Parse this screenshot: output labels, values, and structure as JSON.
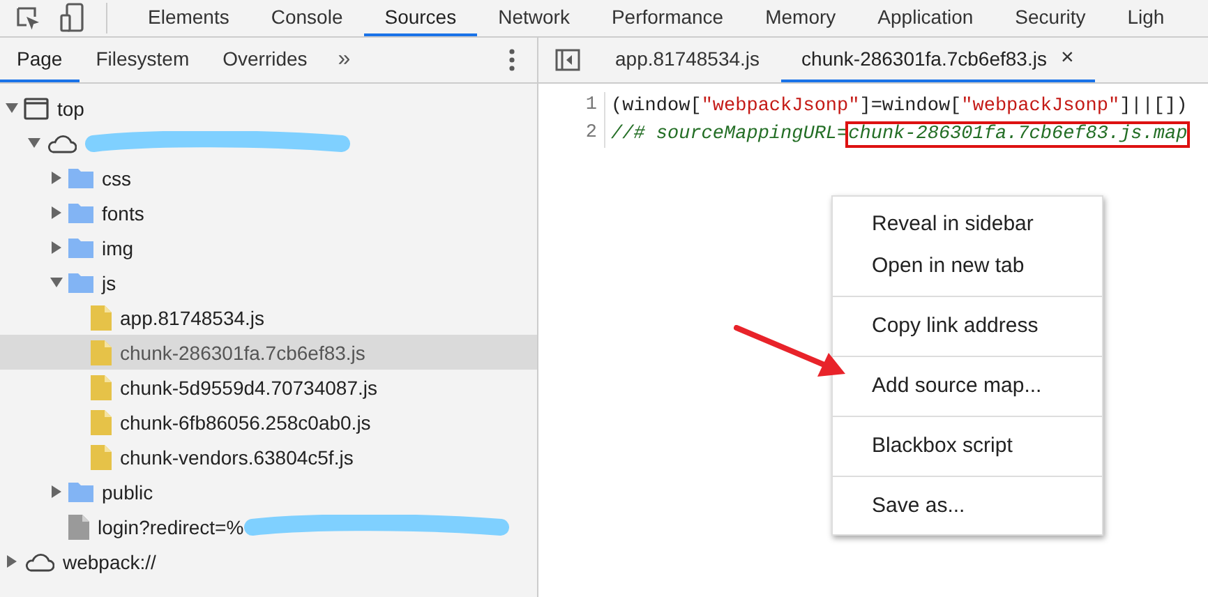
{
  "main_tabs": [
    {
      "label": "Elements",
      "selected": false
    },
    {
      "label": "Console",
      "selected": false
    },
    {
      "label": "Sources",
      "selected": true
    },
    {
      "label": "Network",
      "selected": false
    },
    {
      "label": "Performance",
      "selected": false
    },
    {
      "label": "Memory",
      "selected": false
    },
    {
      "label": "Application",
      "selected": false
    },
    {
      "label": "Security",
      "selected": false
    },
    {
      "label": "Ligh",
      "selected": false
    }
  ],
  "navigator": {
    "tabs": [
      {
        "label": "Page",
        "selected": true
      },
      {
        "label": "Filesystem",
        "selected": false
      },
      {
        "label": "Overrides",
        "selected": false
      }
    ],
    "more": "»"
  },
  "tree": [
    {
      "kind": "frame",
      "label": "top",
      "expanded": true,
      "selected": false,
      "children": [
        {
          "kind": "origin",
          "redacted": true,
          "expanded": true,
          "selected": false,
          "children": [
            {
              "kind": "folder",
              "label": "css",
              "expanded": false,
              "selected": false
            },
            {
              "kind": "folder",
              "label": "fonts",
              "expanded": false,
              "selected": false
            },
            {
              "kind": "folder",
              "label": "img",
              "expanded": false,
              "selected": false
            },
            {
              "kind": "folder",
              "label": "js",
              "expanded": true,
              "selected": false,
              "children": [
                {
                  "kind": "script",
                  "label": "app.81748534.js",
                  "selected": false
                },
                {
                  "kind": "script",
                  "label": "chunk-286301fa.7cb6ef83.js",
                  "selected": true
                },
                {
                  "kind": "script",
                  "label": "chunk-5d9559d4.70734087.js",
                  "selected": false
                },
                {
                  "kind": "script",
                  "label": "chunk-6fb86056.258c0ab0.js",
                  "selected": false
                },
                {
                  "kind": "script",
                  "label": "chunk-vendors.63804c5f.js",
                  "selected": false
                }
              ]
            },
            {
              "kind": "folder",
              "label": "public",
              "expanded": false,
              "selected": false
            },
            {
              "kind": "document",
              "label": "login?redirect=%",
              "redacted": true,
              "selected": false
            }
          ]
        }
      ]
    },
    {
      "kind": "origin",
      "label": "webpack://",
      "expanded": false,
      "selected": false
    }
  ],
  "editor_tabs": [
    {
      "label": "app.81748534.js",
      "selected": false,
      "closable": false
    },
    {
      "label": "chunk-286301fa.7cb6ef83.js",
      "selected": true,
      "closable": true,
      "close": "×"
    }
  ],
  "code": [
    {
      "number": "1",
      "tokens": [
        {
          "kind": "plain",
          "text": "(window["
        },
        {
          "kind": "string",
          "text": "\"webpackJsonp\""
        },
        {
          "kind": "plain",
          "text": "]=window["
        },
        {
          "kind": "string",
          "text": "\"webpackJsonp\""
        },
        {
          "kind": "plain",
          "text": "]||[])"
        }
      ]
    },
    {
      "number": "2",
      "tokens": [
        {
          "kind": "comment",
          "text": "//# sourceMappingURL="
        },
        {
          "kind": "comment",
          "text": "chunk-286301fa.7cb6ef83.js.map",
          "highlighted": true
        }
      ]
    }
  ],
  "context_menu": [
    {
      "kind": "item",
      "label": "Reveal in sidebar"
    },
    {
      "kind": "item",
      "label": "Open in new tab"
    },
    {
      "kind": "separator"
    },
    {
      "kind": "item",
      "label": "Copy link address"
    },
    {
      "kind": "separator"
    },
    {
      "kind": "item",
      "label": "Add source map..."
    },
    {
      "kind": "separator"
    },
    {
      "kind": "item",
      "label": "Blackbox script"
    },
    {
      "kind": "separator"
    },
    {
      "kind": "item",
      "label": "Save as..."
    }
  ]
}
